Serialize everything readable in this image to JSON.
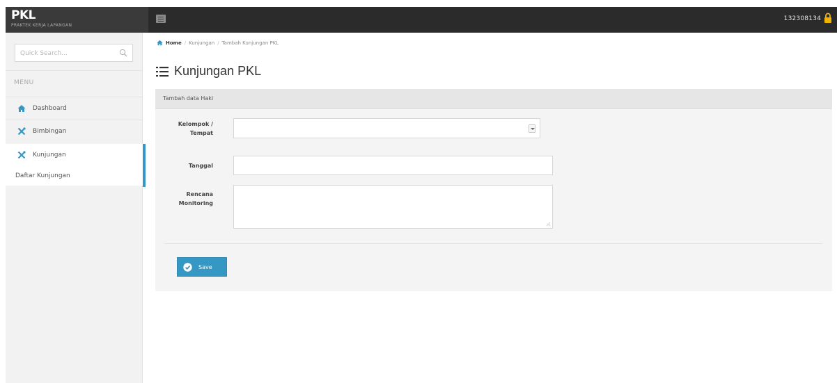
{
  "app": {
    "title": "PKL",
    "subtitle": "PRAKTEK KERJA LAPANGAN"
  },
  "header": {
    "user_id": "132308134"
  },
  "sidebar": {
    "search": {
      "placeholder": "Quick Search..."
    },
    "menu_heading": "MENU",
    "items": [
      {
        "label": "Dashboard",
        "icon": "home-icon"
      },
      {
        "label": "Bimbingan",
        "icon": "tools-icon"
      },
      {
        "label": "Kunjungan",
        "icon": "tools-icon",
        "active": true
      }
    ],
    "sub_items": [
      {
        "label": "Daftar Kunjungan"
      }
    ]
  },
  "breadcrumb": {
    "home": "Home",
    "items": [
      "Kunjungan",
      "Tambah Kunjungan PKL"
    ]
  },
  "page": {
    "title": "Kunjungan PKL"
  },
  "panel": {
    "header": "Tambah data Haki",
    "fields": {
      "kelompok": {
        "label_line1": "Kelompok /",
        "label_line2": "Tempat",
        "value": ""
      },
      "tanggal": {
        "label": "Tanggal",
        "value": ""
      },
      "rencana": {
        "label_line1": "Rencana",
        "label_line2": "Monitoring",
        "value": ""
      }
    },
    "save_label": "Save"
  },
  "colors": {
    "accent": "#3598c4",
    "topbar": "#2b2b2b",
    "lock": "#f0b400",
    "nav_icon": "#3598c4"
  }
}
